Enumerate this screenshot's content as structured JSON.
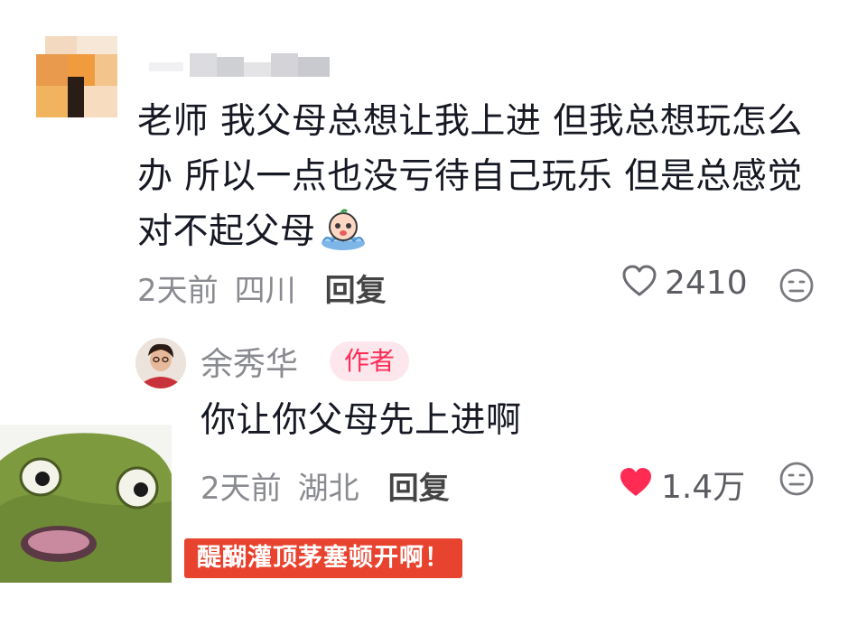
{
  "comment1": {
    "text": "老师 我父母总想让我上进 但我总想玩怎么办 所以一点也没亏待自己玩乐 但是总感觉对不起父母",
    "time": "2天前",
    "location": "四川",
    "reply_label": "回复",
    "likes": "2410",
    "liked": false
  },
  "comment2": {
    "author": "余秀华",
    "badge": "作者",
    "text": "你让你父母先上进啊",
    "time": "2天前",
    "location": "湖北",
    "reply_label": "回复",
    "likes": "1.4万",
    "liked": true
  },
  "sticker": {
    "caption": "醍醐灌顶茅塞顿开啊！"
  },
  "colors": {
    "like_active": "#fe2c55",
    "caption_bg": "#e8432f",
    "badge_text": "#fe2c55"
  }
}
